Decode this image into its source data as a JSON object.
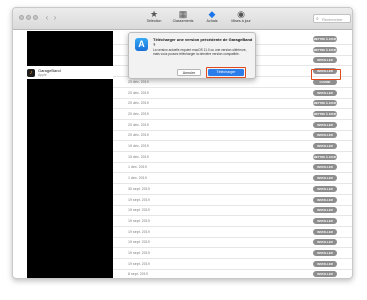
{
  "toolbar": {
    "items": [
      {
        "label": "Sélection",
        "icon": "star-icon"
      },
      {
        "label": "Classements",
        "icon": "grid-icon"
      },
      {
        "label": "Achats",
        "icon": "tag-icon"
      },
      {
        "label": "Mises à jour",
        "icon": "update-icon"
      }
    ],
    "active_index": 2,
    "search_placeholder": "Rechercher"
  },
  "app": {
    "name": "GarageBand",
    "developer": "Apple"
  },
  "dialog": {
    "title": "Télécharger une version précédente de GarageBand ?",
    "body": "La version actuelle requiert macOS 11.0 ou une version ultérieure, mais vous pouvez télécharger la dernière version compatible.",
    "cancel_label": "Annuler",
    "ok_label": "Télécharger"
  },
  "rows": [
    {
      "date": "",
      "button": "METTRE À JOUR"
    },
    {
      "date": "",
      "button": "METTRE À JOUR"
    },
    {
      "date": "",
      "button": "INSTALLER"
    },
    {
      "date": "20 déc. 2019",
      "button": "INSTALLER"
    },
    {
      "date": "20 déc. 2019",
      "button": "OUVRIR"
    },
    {
      "date": "20 déc. 2019",
      "button": "INSTALLER"
    },
    {
      "date": "20 déc. 2019",
      "button": "METTRE À JOUR"
    },
    {
      "date": "20 déc. 2019",
      "button": "METTRE À JOUR"
    },
    {
      "date": "20 déc. 2019",
      "button": "INSTALLER"
    },
    {
      "date": "20 déc. 2019",
      "button": "INSTALLER"
    },
    {
      "date": "19 déc. 2019",
      "button": "INSTALLER"
    },
    {
      "date": "15 déc. 2019",
      "button": "METTRE À JOUR"
    },
    {
      "date": "1 déc. 2019",
      "button": "INSTALLER"
    },
    {
      "date": "1 déc. 2019",
      "button": "INSTALLER"
    },
    {
      "date": "30 sept. 2019",
      "button": "INSTALLER"
    },
    {
      "date": "19 sept. 2019",
      "button": "INSTALLER"
    },
    {
      "date": "19 sept. 2019",
      "button": "INSTALLER"
    },
    {
      "date": "19 sept. 2019",
      "button": "INSTALLER"
    },
    {
      "date": "19 sept. 2019",
      "button": "INSTALLER"
    },
    {
      "date": "19 sept. 2019",
      "button": "INSTALLER"
    },
    {
      "date": "19 sept. 2019",
      "button": "INSTALLER"
    },
    {
      "date": "19 sept. 2019",
      "button": "INSTALLER"
    },
    {
      "date": "8 sept. 2019",
      "button": "INSTALLER"
    }
  ],
  "colors": {
    "accent": "#2b7de9",
    "highlight": "#e04a1f",
    "button_gray": "#8e8e8e"
  }
}
